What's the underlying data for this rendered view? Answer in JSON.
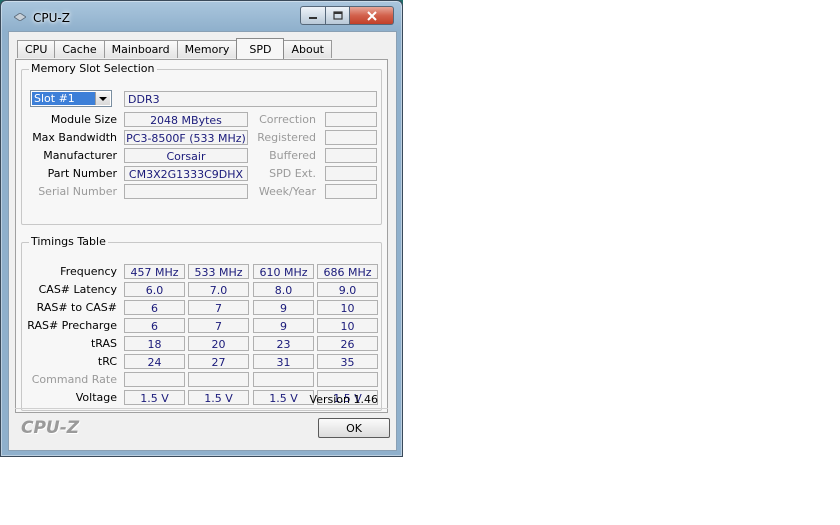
{
  "window": {
    "title": "CPU-Z",
    "tabs": [
      "CPU",
      "Cache",
      "Mainboard",
      "Memory",
      "SPD",
      "About"
    ],
    "active_tab": "SPD"
  },
  "memory_slot": {
    "group_title": "Memory Slot Selection",
    "slot_selected": "Slot #1",
    "memory_type": "DDR3",
    "labels": {
      "module_size": "Module Size",
      "max_bandwidth": "Max Bandwidth",
      "manufacturer": "Manufacturer",
      "part_number": "Part Number",
      "serial_number": "Serial Number",
      "correction": "Correction",
      "registered": "Registered",
      "buffered": "Buffered",
      "spd_ext": "SPD Ext.",
      "week_year": "Week/Year"
    },
    "values": {
      "module_size": "2048 MBytes",
      "max_bandwidth": "PC3-8500F (533 MHz)",
      "manufacturer": "Corsair",
      "part_number": "CM3X2G1333C9DHX",
      "serial_number": "",
      "correction": "",
      "registered": "",
      "buffered": "",
      "spd_ext": "",
      "week_year": ""
    }
  },
  "timings": {
    "group_title": "Timings Table",
    "rows": [
      {
        "label": "Frequency",
        "values": [
          "457 MHz",
          "533 MHz",
          "610 MHz",
          "686 MHz"
        ],
        "dim": false
      },
      {
        "label": "CAS# Latency",
        "values": [
          "6.0",
          "7.0",
          "8.0",
          "9.0"
        ],
        "dim": false
      },
      {
        "label": "RAS# to CAS#",
        "values": [
          "6",
          "7",
          "9",
          "10"
        ],
        "dim": false
      },
      {
        "label": "RAS# Precharge",
        "values": [
          "6",
          "7",
          "9",
          "10"
        ],
        "dim": false
      },
      {
        "label": "tRAS",
        "values": [
          "18",
          "20",
          "23",
          "26"
        ],
        "dim": false
      },
      {
        "label": "tRC",
        "values": [
          "24",
          "27",
          "31",
          "35"
        ],
        "dim": false
      },
      {
        "label": "Command Rate",
        "values": [
          "",
          "",
          "",
          ""
        ],
        "dim": true
      },
      {
        "label": "Voltage",
        "values": [
          "1.5 V",
          "1.5 V",
          "1.5 V",
          "1.5 V"
        ],
        "dim": false
      }
    ]
  },
  "footer": {
    "version": "Version 1.46",
    "logo": "CPU-Z",
    "ok_label": "OK"
  },
  "colors": {
    "value_text": "#1a1a7a",
    "selection": "#3c7fd8",
    "close_button": "#c2402a"
  }
}
